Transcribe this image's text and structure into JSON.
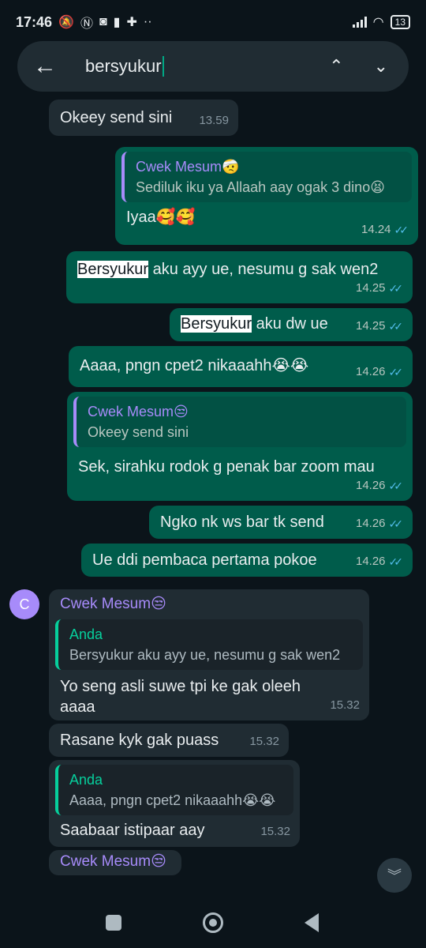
{
  "status": {
    "time": "17:46",
    "battery": "13",
    "icons": [
      "mute-bell-icon",
      "nfc-icon",
      "instagram-icon",
      "file-icon",
      "battery-saver-icon",
      "more-icon",
      "signal-icon",
      "wifi-icon"
    ],
    "dots": "··"
  },
  "search": {
    "query": "bersyukur",
    "back_glyph": "←",
    "up_glyph": "⌃",
    "down_glyph": "⌄"
  },
  "messages": {
    "m0": {
      "text": "Okeey send sini",
      "time": "13.59"
    },
    "m1": {
      "quote_name": "Cwek Mesum🤕",
      "quote_text": "Sediluk iku ya Allaah aay ogak 3 dino😫",
      "text": "Iyaa🥰🥰",
      "time": "14.24"
    },
    "m2": {
      "highlight": "Bersyukur",
      "text": " aku ayy ue, nesumu g sak wen2",
      "time": "14.25"
    },
    "m3": {
      "highlight": "Bersyukur",
      "text": " aku dw ue",
      "time": "14.25"
    },
    "m4": {
      "text": "Aaaa, pngn cpet2 nikaaahh😭😭",
      "time": "14.26"
    },
    "m5": {
      "quote_name": "Cwek Mesum😒",
      "quote_text": "Okeey send sini",
      "text": "Sek, sirahku rodok g penak bar zoom mau",
      "time": "14.26"
    },
    "m6": {
      "text": "Ngko nk ws bar tk send",
      "time": "14.26"
    },
    "m7": {
      "text": "Ue ddi pembaca pertama pokoe",
      "time": "14.26"
    },
    "m8": {
      "avatar": "C",
      "sender": "Cwek Mesum😒",
      "quote_name": "Anda",
      "quote_text": "Bersyukur aku ayy ue, nesumu g sak wen2",
      "text_line1": "Yo seng asli suwe tpi ke gak oleeh",
      "text_line2": "aaaa",
      "time": "15.32"
    },
    "m9": {
      "text": "Rasane kyk gak puass",
      "time": "15.32"
    },
    "m10": {
      "quote_name": "Anda",
      "quote_text": "Aaaa, pngn cpet2 nikaaahh😭😭",
      "text": "Saabaar istipaar aay",
      "time": "15.32"
    },
    "m11": {
      "sender": "Cwek Mesum😒"
    }
  },
  "ticks": "✓✓",
  "scroll_glyph": "︾",
  "colors": {
    "background": "#0b141a",
    "outgoing_bubble": "#005c4b",
    "incoming_bubble": "#202c33",
    "read_ticks": "#53bdeb",
    "sender_name": "#a78bfa",
    "quote_self": "#06cf9c"
  }
}
